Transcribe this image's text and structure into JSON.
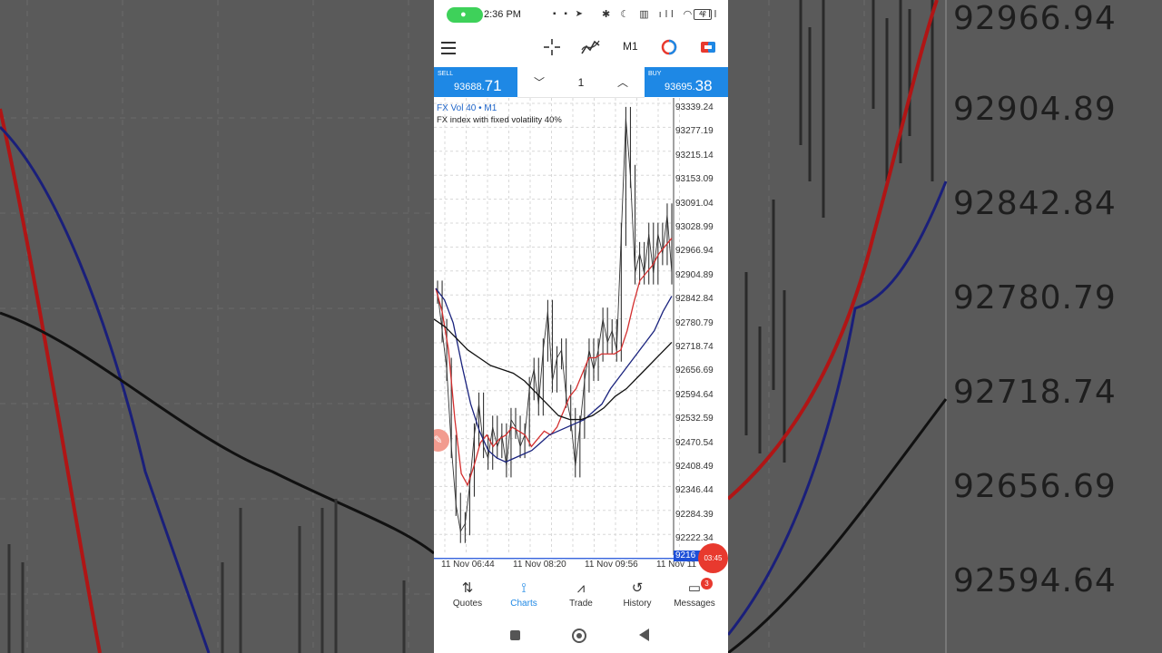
{
  "status_bar": {
    "time": "2:36 PM",
    "mic_icon": "mic-icon",
    "left_icons": "▪ ▪ ➤",
    "right_icons": "✱ ☾ ▥ ıll ◠ ıll",
    "battery": "42"
  },
  "toolbar": {
    "menu_icon": "hamburger-menu-icon",
    "crosshair_icon": "crosshair-icon",
    "indicators_icon": "indicators-icon",
    "timeframe": "M1",
    "colors": {
      "icon_red": "#e8392e",
      "icon_blue": "#1e88e5"
    }
  },
  "trade": {
    "sell_label": "SELL",
    "sell_price_main": "93688.",
    "sell_price_big": "71",
    "buy_label": "BUY",
    "buy_price_main": "93695.",
    "buy_price_big": "38",
    "lot": "1",
    "colors": {
      "box": "#1e88e5"
    }
  },
  "chart": {
    "symbol": "FX Vol 40 • M1",
    "description": "FX index with fixed volatility 40%",
    "y_labels": [
      "93339.24",
      "93277.19",
      "93215.14",
      "93153.09",
      "93091.04",
      "93028.99",
      "92966.94",
      "92904.89",
      "92842.84",
      "92780.79",
      "92718.74",
      "92656.69",
      "92594.64",
      "92532.59",
      "92470.54",
      "92408.49",
      "92346.44",
      "92284.39",
      "92222.34"
    ],
    "x_labels": [
      "11 Nov 06:44",
      "11 Nov 08:20",
      "11 Nov 09:56",
      "11 Nov 11"
    ],
    "current_price_label": "9216",
    "timer": "03:45"
  },
  "chart_data": {
    "type": "line",
    "title": "FX Vol 40 • M1",
    "subtitle": "FX index with fixed volatility 40%",
    "ylim": [
      92160,
      93360
    ],
    "x": [
      "11 Nov 06:44",
      "11 Nov 08:20",
      "11 Nov 09:56",
      "11 Nov 11"
    ],
    "series": [
      {
        "values": [
          92850,
          92750,
          92650,
          92450,
          92300,
          92230,
          92250,
          92350,
          92480,
          92560,
          92450,
          92420,
          92500,
          92450,
          92480,
          92400,
          92520,
          92500,
          92450,
          92480,
          92600,
          92650,
          92560,
          92700,
          92800,
          92620,
          92680,
          92700,
          92580,
          92520,
          92400,
          92500,
          92620,
          92700,
          92650,
          92700,
          92780,
          92720,
          92750,
          92700,
          93000,
          93300,
          93150,
          92900,
          92950,
          92900,
          93000,
          92900,
          93000,
          92950,
          93050,
          92900
        ]
      },
      {
        "values": [
          92860,
          92800,
          92700,
          92520,
          92380,
          92350,
          92400,
          92460,
          92480,
          92450,
          92470,
          92480,
          92500,
          92490,
          92480,
          92450,
          92470,
          92490,
          92480,
          92500,
          92540,
          92580,
          92600,
          92640,
          92680,
          92680,
          92690,
          92690,
          92690,
          92700,
          92750,
          92820,
          92880,
          92900,
          92920,
          92950,
          92970,
          92990
        ]
      },
      {
        "values": [
          92860,
          92830,
          92770,
          92660,
          92560,
          92490,
          92440,
          92420,
          92410,
          92420,
          92430,
          92440,
          92460,
          92480,
          92490,
          92500,
          92510,
          92520,
          92540,
          92560,
          92600,
          92630,
          92660,
          92690,
          92720,
          92750,
          92800,
          92840
        ]
      },
      {
        "values": [
          92780,
          92760,
          92730,
          92700,
          92680,
          92660,
          92650,
          92640,
          92620,
          92590,
          92560,
          92530,
          92520,
          92520,
          92530,
          92550,
          92580,
          92600,
          92630,
          92660,
          92690,
          92720
        ]
      }
    ],
    "series_colors": [
      "#333333",
      "#d32f2f",
      "#1a237e",
      "#111111"
    ],
    "current_price": 92160,
    "grid": true
  },
  "bottom_nav": [
    {
      "label": "Quotes",
      "icon": "quotes-icon",
      "glyph": "⇅"
    },
    {
      "label": "Charts",
      "icon": "charts-icon",
      "glyph": "⟟"
    },
    {
      "label": "Trade",
      "icon": "trade-icon",
      "glyph": "⩘"
    },
    {
      "label": "History",
      "icon": "history-icon",
      "glyph": "↺"
    },
    {
      "label": "Messages",
      "icon": "messages-icon",
      "glyph": "▭",
      "badge": "3"
    }
  ],
  "background_prices": [
    "92966.94",
    "92904.89",
    "92842.84",
    "92780.79",
    "92718.74",
    "92656.69",
    "92594.64"
  ]
}
